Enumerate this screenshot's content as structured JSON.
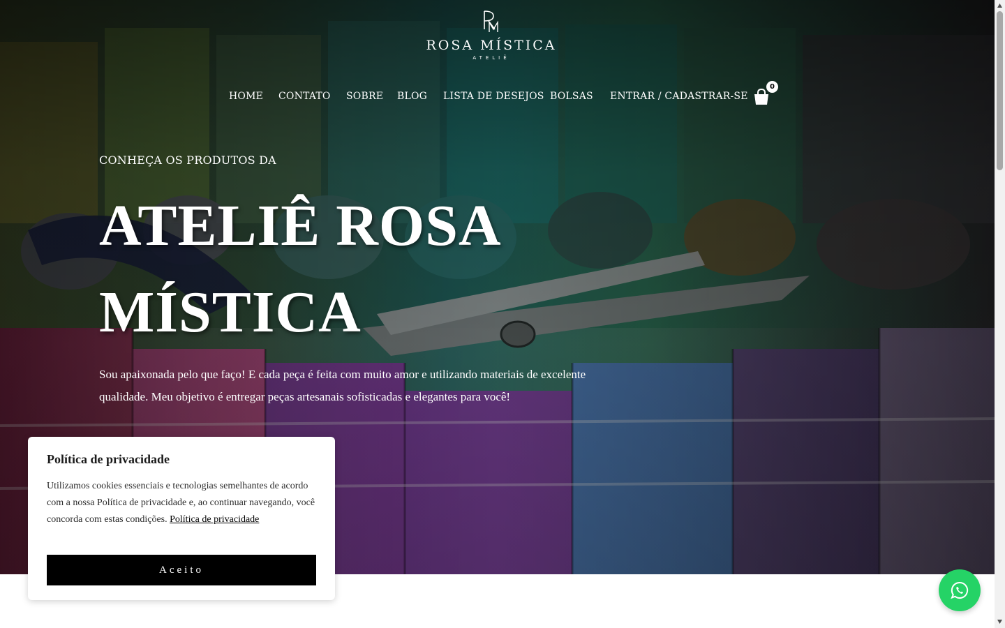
{
  "header": {
    "logo_monogram": "RM",
    "logo_name": "ROSA MÍSTICA",
    "logo_sub": "ATELIÊ",
    "nav": [
      {
        "label": "HOME"
      },
      {
        "label": "CONTATO"
      },
      {
        "label": "SOBRE"
      },
      {
        "label": "BLOG"
      },
      {
        "label": "LISTA DE DESEJOS"
      },
      {
        "label": "BOLSAS"
      },
      {
        "label": "ENTRAR / CADASTRAR-SE"
      }
    ],
    "cart_icon": "shopping-bag-icon",
    "cart_count": "0"
  },
  "hero": {
    "eyebrow": "CONHEÇA OS PRODUTOS DA",
    "headline": "ATELIÊ ROSA MÍSTICA",
    "lead": "Sou apaixonada pelo que faço! E cada peça é feita com muito amor e utilizando materiais de excelente qualidade. Meu objetivo é entregar peças artesanais sofisticadas e elegantes para você!"
  },
  "cookie": {
    "title": "Política de privacidade",
    "text": "Utilizamos cookies essenciais e tecnologias semelhantes de acordo com a nossa Política de privacidade e, ao continuar navegando, você concorda com estas condições.",
    "link": "Política de privacidade",
    "button": "Aceito"
  },
  "whatsapp": {
    "icon": "whatsapp-icon",
    "color": "#25d366"
  },
  "colors": {
    "button_bg": "#000000",
    "text_light": "#ffffff"
  }
}
